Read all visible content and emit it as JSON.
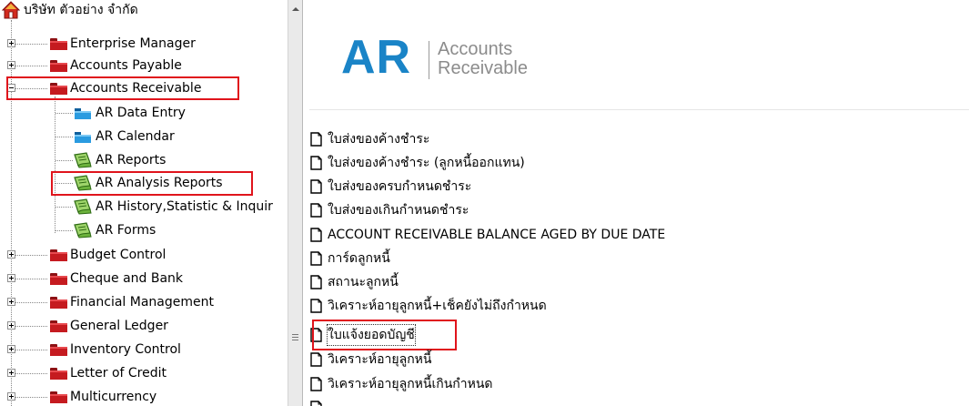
{
  "tree": {
    "root_label": "บริษัท ตัวอย่าง จำกัด",
    "items": [
      {
        "label": "Enterprise Manager"
      },
      {
        "label": "Accounts Payable"
      },
      {
        "label": "Accounts Receivable"
      },
      {
        "label": "AR Data Entry"
      },
      {
        "label": "AR Calendar"
      },
      {
        "label": "AR Reports"
      },
      {
        "label": "AR Analysis Reports"
      },
      {
        "label": "AR History,Statistic & Inquir"
      },
      {
        "label": "AR Forms"
      },
      {
        "label": "Budget Control"
      },
      {
        "label": "Cheque and Bank"
      },
      {
        "label": "Financial Management"
      },
      {
        "label": "General Ledger"
      },
      {
        "label": "Inventory Control"
      },
      {
        "label": "Letter of Credit"
      },
      {
        "label": "Multicurrency"
      }
    ]
  },
  "header": {
    "logo_text": "AR",
    "subtitle_line1": "Accounts",
    "subtitle_line2": "Receivable"
  },
  "documents": [
    {
      "label": "ใบส่งของค้างชำระ"
    },
    {
      "label": "ใบส่งของค้างชำระ (ลูกหนี้ออกแทน)"
    },
    {
      "label": "ใบส่งของครบกำหนดชำระ"
    },
    {
      "label": "ใบส่งของเกินกำหนดชำระ"
    },
    {
      "label": "ACCOUNT RECEIVABLE BALANCE AGED BY DUE DATE"
    },
    {
      "label": "การ์ดลูกหนี้"
    },
    {
      "label": "สถานะลูกหนี้"
    },
    {
      "label": "วิเคราะห์อายุลูกหนี้+เช็คยังไม่ถึงกำหนด"
    },
    {
      "label": "ใบแจ้งยอดบัญชี"
    },
    {
      "label": "วิเคราะห์อายุลูกหนี้"
    },
    {
      "label": "วิเคราะห์อายุลูกหนี้เกินกำหนด"
    }
  ],
  "icons": {
    "root": "home-icon",
    "module": "folder-icon",
    "entry": "folder-icon",
    "report": "report-icon",
    "document": "document-icon"
  },
  "colors": {
    "accent": "#1a84c7",
    "folder_red": "#c51b20",
    "highlight": "#e0141c"
  }
}
